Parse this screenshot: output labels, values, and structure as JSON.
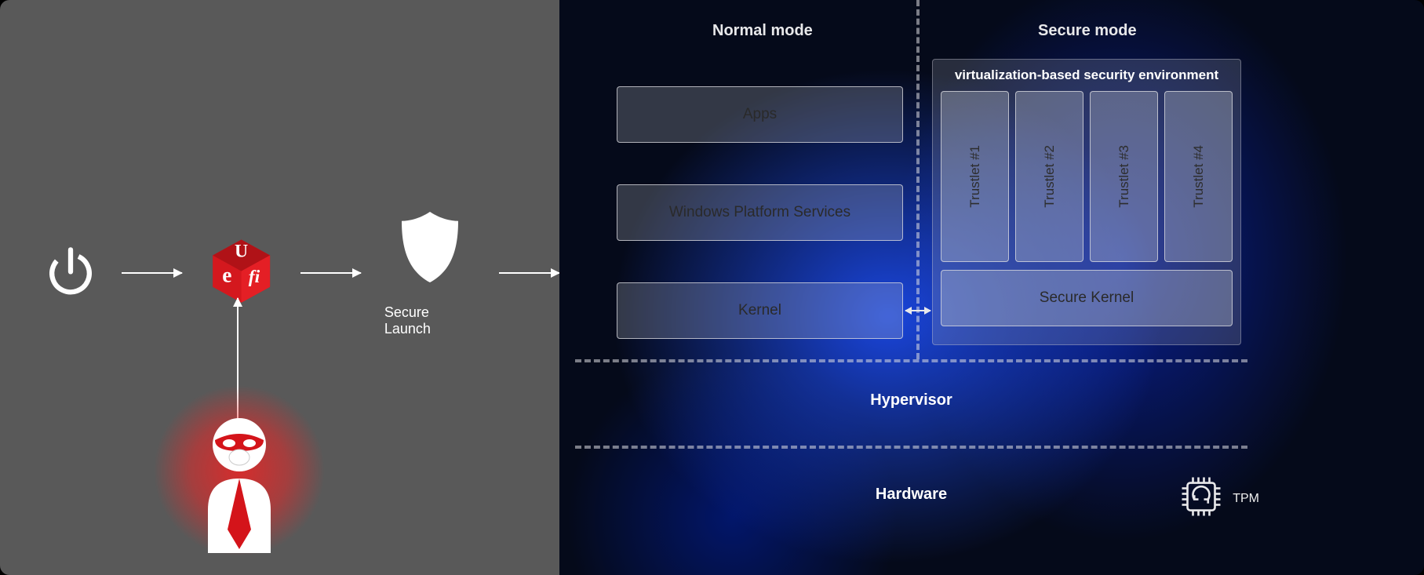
{
  "left": {
    "secure_launch_label": "Secure Launch",
    "icons": {
      "power": "power-icon",
      "uefi": "uefi-icon",
      "shield": "shield-icon",
      "attacker": "attacker-icon"
    },
    "uefi_text": {
      "u": "U",
      "e": "e",
      "fi": "fi"
    }
  },
  "right": {
    "mode_normal": "Normal mode",
    "mode_secure": "Secure mode",
    "apps": "Apps",
    "wps": "Windows Platform Services",
    "kernel": "Kernel",
    "vbs_title": "virtualization-based security environment",
    "trustlets": [
      "Trustlet #1",
      "Trustlet #2",
      "Trustlet #3",
      "Trustlet #4"
    ],
    "secure_kernel": "Secure Kernel",
    "hypervisor": "Hypervisor",
    "hardware": "Hardware",
    "tpm": "TPM"
  }
}
